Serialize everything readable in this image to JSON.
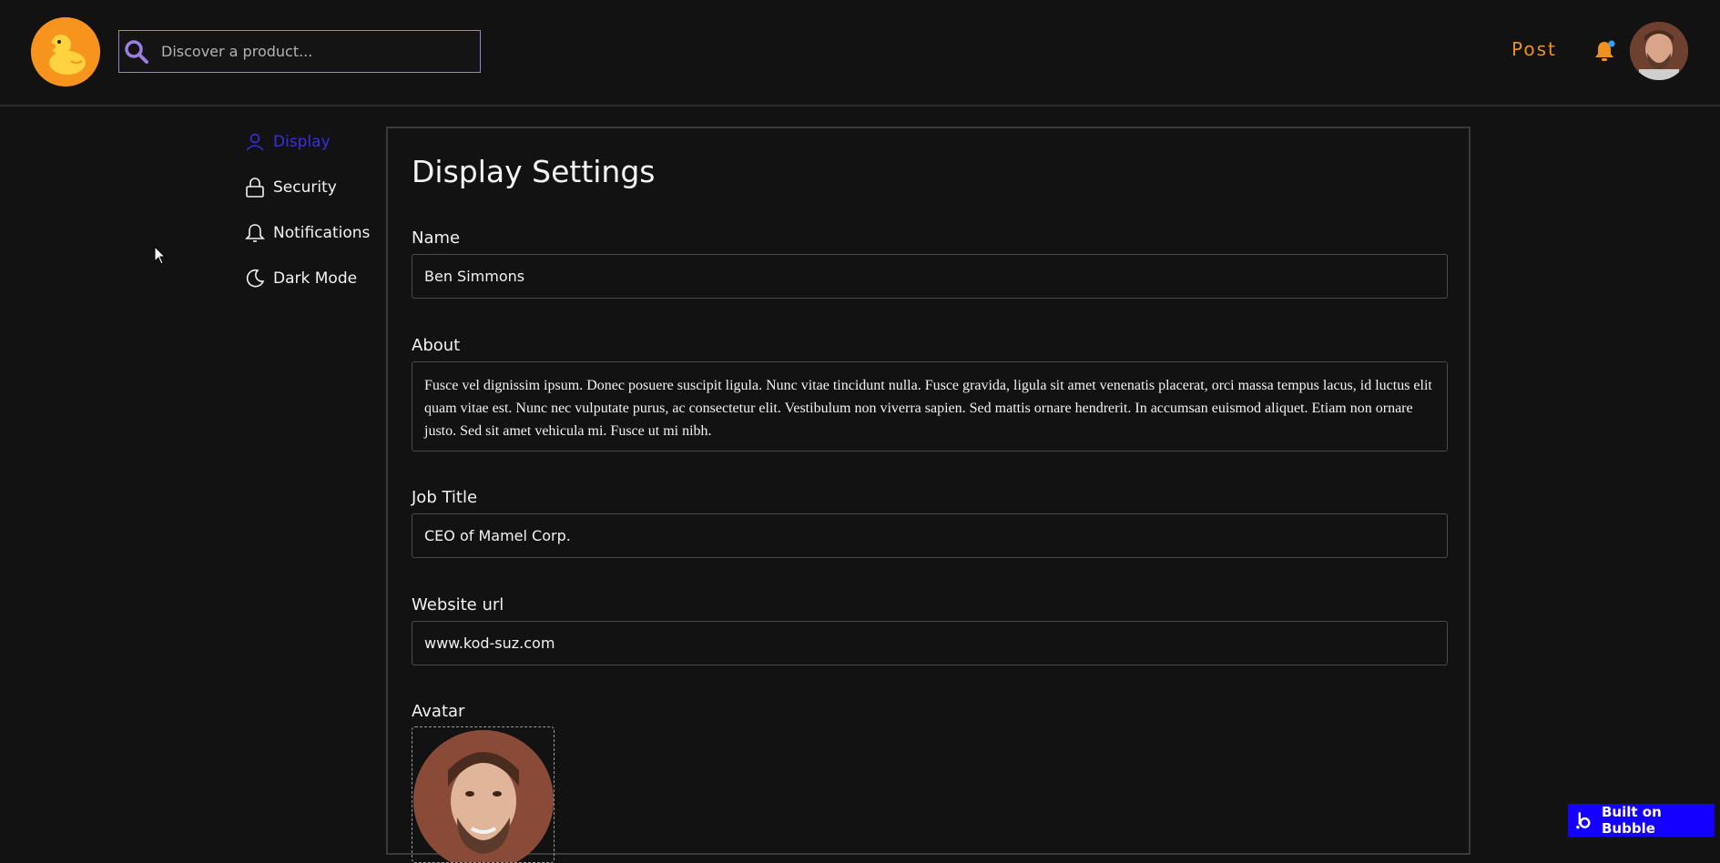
{
  "header": {
    "search_placeholder": "Discover a product...",
    "post_label": "Post"
  },
  "sidebar": {
    "items": [
      {
        "label": "Display",
        "icon": "user-icon",
        "active": true
      },
      {
        "label": "Security",
        "icon": "lock-icon",
        "active": false
      },
      {
        "label": "Notifications",
        "icon": "bell-icon",
        "active": false
      },
      {
        "label": "Dark Mode",
        "icon": "moon-icon",
        "active": false
      }
    ]
  },
  "settings": {
    "title": "Display Settings",
    "name_label": "Name",
    "name_value": "Ben Simmons",
    "about_label": "About",
    "about_value": "Fusce vel dignissim ipsum. Donec posuere suscipit ligula. Nunc vitae tincidunt nulla. Fusce gravida, ligula sit amet venenatis placerat, orci massa tempus lacus, id luctus elit quam vitae est. Nunc nec vulputate purus, ac consectetur elit. Vestibulum non viverra sapien. Sed mattis ornare hendrerit. In accumsan euismod aliquet. Etiam non ornare justo. Sed sit amet vehicula mi. Fusce ut mi nibh.",
    "job_label": "Job Title",
    "job_value": "CEO of Mamel Corp.",
    "website_label": "Website url",
    "website_value": "www.kod-suz.com",
    "avatar_label": "Avatar"
  },
  "badge": {
    "label": "Built on Bubble"
  },
  "colors": {
    "accent_orange": "#f0901f",
    "active_nav": "#3a2fe0",
    "search_border": "#9b7fe0",
    "badge_bg": "#1400ff",
    "background": "#121212"
  }
}
